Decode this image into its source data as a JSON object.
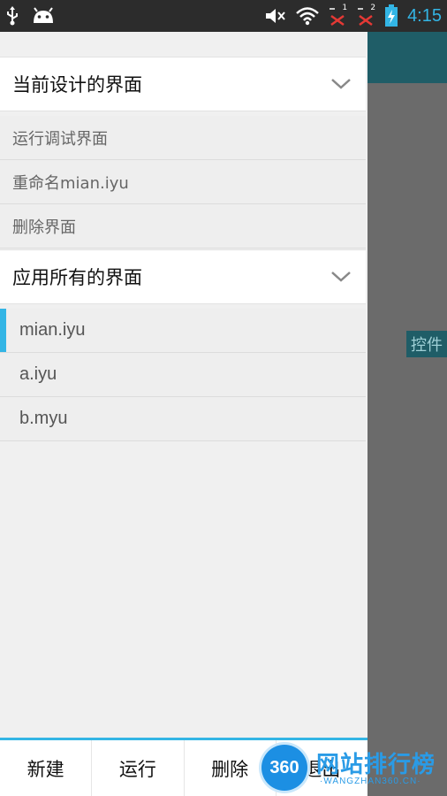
{
  "status_bar": {
    "time": "4:15",
    "icons": [
      "usb-icon",
      "android-icon",
      "mute-icon",
      "wifi-icon",
      "sim1-no-signal-icon",
      "sim2-no-signal-icon",
      "battery-charging-icon"
    ],
    "sim1_label": "1",
    "sim2_label": "2"
  },
  "background_app": {
    "chip_label": "控件"
  },
  "drawer": {
    "current_section": {
      "title": "当前设计的界面",
      "items": [
        "运行调试界面",
        "重命名mian.iyu",
        "删除界面"
      ]
    },
    "all_section": {
      "title": "应用所有的界面",
      "files": [
        {
          "name": "mian.iyu",
          "active": true
        },
        {
          "name": "a.iyu",
          "active": false
        },
        {
          "name": "b.myu",
          "active": false
        }
      ]
    }
  },
  "bottom_bar": {
    "buttons": [
      "新建",
      "运行",
      "删除",
      "退出"
    ]
  },
  "watermark": {
    "badge": "360",
    "text": "网站排行榜",
    "sub": "·WANGZHAN360.CN·"
  },
  "colors": {
    "accent": "#33b5e5",
    "teal": "#1f5d67",
    "overlay": "#6b6b6b"
  }
}
